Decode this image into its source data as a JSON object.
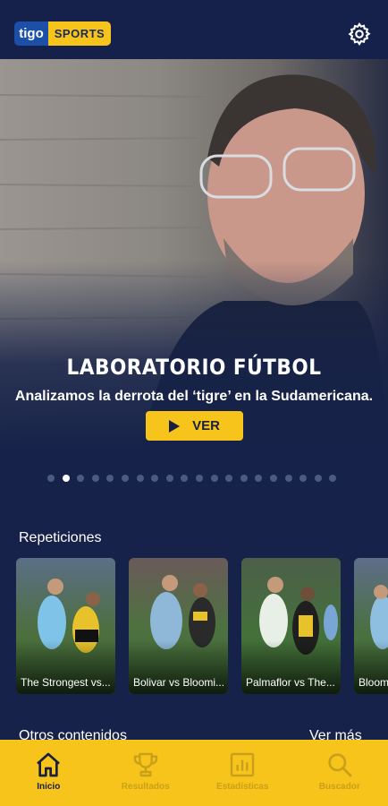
{
  "header": {
    "logo_left": "tigo",
    "logo_right": "SPORTS",
    "settings_icon": "gear-icon"
  },
  "hero": {
    "title": "LABORATORIO FÚTBOL",
    "subtitle": "Analizamos la derrota del ‘tigre’ en la Sudamericana.",
    "cta_label": "VER",
    "carousel_count": 20,
    "carousel_active_index": 1
  },
  "repeticiones": {
    "title": "Repeticiones",
    "items": [
      {
        "caption": "The Strongest vs..."
      },
      {
        "caption": "Bolivar vs Bloomi..."
      },
      {
        "caption": "Palmaflor vs The..."
      },
      {
        "caption": "Bloomi..."
      }
    ]
  },
  "otros": {
    "title": "Otros contenidos",
    "more_label": "Ver más"
  },
  "nav": {
    "items": [
      {
        "label": "Inicio",
        "icon": "home-icon",
        "active": true
      },
      {
        "label": "Resultados",
        "icon": "trophy-icon",
        "active": false
      },
      {
        "label": "Estadísticas",
        "icon": "stats-icon",
        "active": false
      },
      {
        "label": "Buscador",
        "icon": "search-icon",
        "active": false
      }
    ]
  },
  "colors": {
    "background": "#162249",
    "accent": "#f6c41a",
    "nav_active": "#1a2040",
    "nav_inactive": "#c9a01b"
  }
}
